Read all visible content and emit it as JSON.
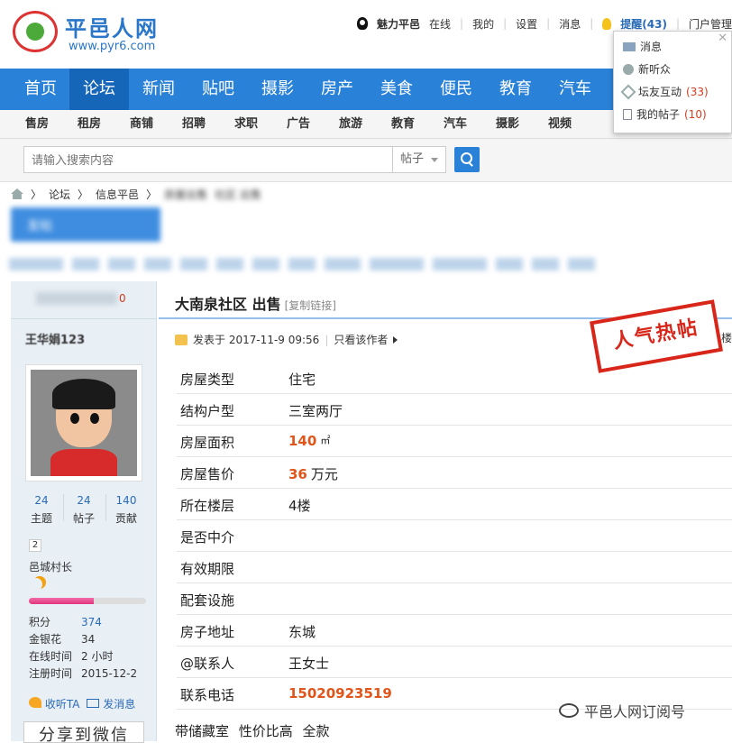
{
  "logo": {
    "name": "平邑人网",
    "url": "www.pyr6.com"
  },
  "topbar": {
    "user": "魅力平邑",
    "online": "在线",
    "mine": "我的",
    "settings": "设置",
    "messages": "消息",
    "reminder": "提醒(43)",
    "portal": "门户管理",
    "user_cut": "用户"
  },
  "reminder_panel": {
    "items": [
      {
        "label": "消息",
        "count": ""
      },
      {
        "label": "新听众",
        "count": ""
      },
      {
        "label": "坛友互动",
        "count": "(33)"
      },
      {
        "label": "我的帖子",
        "count": "(10)"
      }
    ]
  },
  "nav": {
    "items": [
      "首页",
      "论坛",
      "新闻",
      "贴吧",
      "摄影",
      "房产",
      "美食",
      "便民",
      "教育",
      "汽车"
    ],
    "active": "论坛"
  },
  "subnav": {
    "items": [
      "售房",
      "租房",
      "商铺",
      "招聘",
      "求职",
      "广告",
      "旅游",
      "教育",
      "汽车",
      "摄影",
      "视频"
    ]
  },
  "search": {
    "placeholder": "请输入搜索内容",
    "type": "帖子"
  },
  "breadcrumb": {
    "items": [
      "论坛",
      "信息平邑",
      "房屋出售",
      "社区 出售"
    ]
  },
  "post_button": "发帖",
  "sidebar": {
    "head_count": "0",
    "author": "王华娟123",
    "stats": [
      {
        "value": "24",
        "label": "主题"
      },
      {
        "value": "24",
        "label": "帖子"
      },
      {
        "value": "140",
        "label": "贡献"
      }
    ],
    "level": "2",
    "rank": "邑城村长",
    "progress": 0.55,
    "info": [
      {
        "key": "积分",
        "value": "374"
      },
      {
        "key": "金银花",
        "value": "34"
      },
      {
        "key": "在线时间",
        "value": "2 小时"
      },
      {
        "key": "注册时间",
        "value": "2015-12-2"
      }
    ],
    "follow": "收听TA",
    "send_msg": "发消息",
    "share": "分享到微信"
  },
  "post": {
    "title": "大南泉社区 出售",
    "copy_link": "[复制链接]",
    "posted_at": "发表于 2017-11-9 09:56",
    "only_author": "只看该作者",
    "hot_stamp": "人气热帖",
    "floor": "楼",
    "rows": [
      {
        "key": "房屋类型",
        "value": "住宅"
      },
      {
        "key": "结构户型",
        "value": "三室两厅"
      },
      {
        "key": "房屋面积",
        "num": "140",
        "unit": "㎡"
      },
      {
        "key": "房屋售价",
        "num": "36",
        "unit": "万元"
      },
      {
        "key": "所在楼层",
        "value": "4楼"
      },
      {
        "key": "是否中介",
        "value": ""
      },
      {
        "key": "有效期限",
        "value": ""
      },
      {
        "key": "配套设施",
        "value": ""
      },
      {
        "key": "房子地址",
        "value": "东城"
      },
      {
        "key": "@联系人",
        "value": "王女士"
      },
      {
        "key": "联系电话",
        "phone": "15020923519"
      }
    ],
    "features": "带储藏室 性价比高 全款"
  },
  "watermark": "平邑人网订阅号",
  "colors": {
    "nav": "#2a82d8",
    "nav_active": "#1565b8",
    "accent": "#e0551a",
    "stamp": "#d8261a"
  }
}
